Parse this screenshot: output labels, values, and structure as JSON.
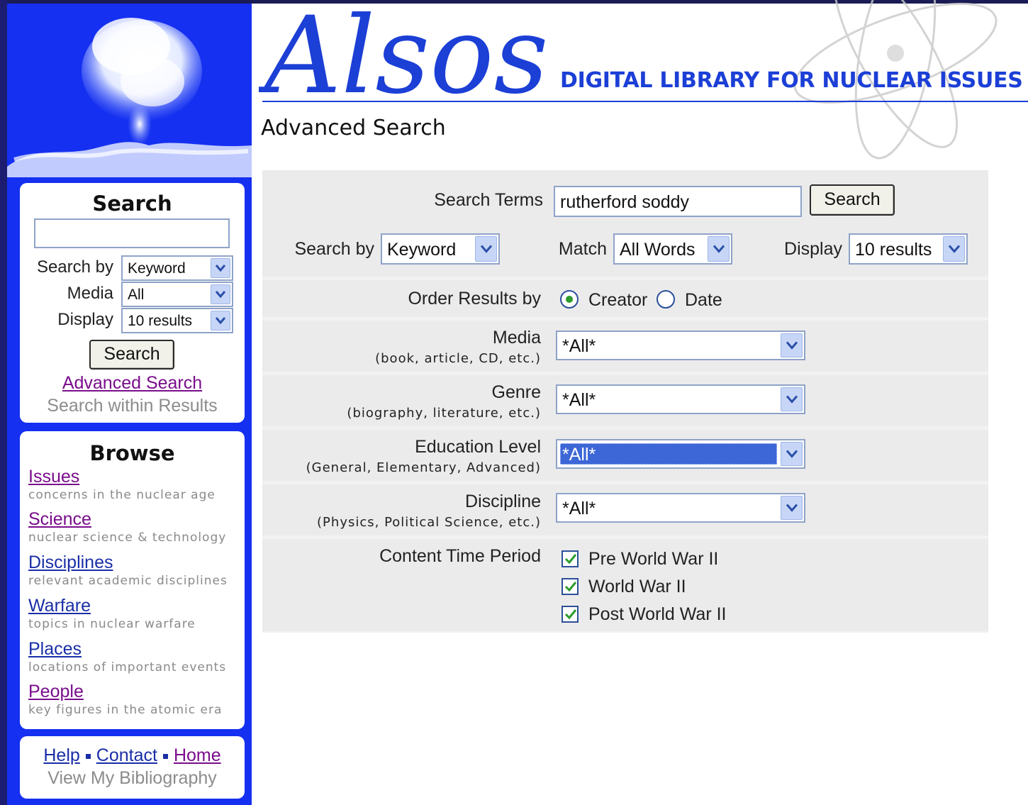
{
  "header": {
    "logo_text": "Alsos",
    "tagline": "DIGITAL LIBRARY FOR NUCLEAR ISSUES",
    "page_title": "Advanced Search"
  },
  "sidebar": {
    "search": {
      "title": "Search",
      "query_value": "",
      "search_by_label": "Search by",
      "search_by_value": "Keyword",
      "media_label": "Media",
      "media_value": "All",
      "display_label": "Display",
      "display_value": "10 results",
      "button_label": "Search",
      "advanced_link": "Advanced Search",
      "within_results": "Search within Results"
    },
    "browse": {
      "title": "Browse",
      "items": [
        {
          "label": "Issues",
          "desc": "concerns in the nuclear age"
        },
        {
          "label": "Science",
          "desc": "nuclear science & technology"
        },
        {
          "label": "Disciplines",
          "desc": "relevant academic disciplines"
        },
        {
          "label": "Warfare",
          "desc": "topics in nuclear warfare"
        },
        {
          "label": "Places",
          "desc": "locations of important events"
        },
        {
          "label": "People",
          "desc": "key figures in the atomic era"
        }
      ]
    },
    "footer": {
      "help": "Help",
      "contact": "Contact",
      "home": "Home",
      "bibliography": "View My Bibliography"
    }
  },
  "form": {
    "search_terms_label": "Search Terms",
    "search_terms_value": "rutherford soddy",
    "search_button": "Search",
    "search_by_label": "Search by",
    "search_by_value": "Keyword",
    "match_label": "Match",
    "match_value": "All Words",
    "display_label": "Display",
    "display_value": "10 results",
    "order_label": "Order Results by",
    "order_options": [
      {
        "label": "Creator",
        "selected": true
      },
      {
        "label": "Date",
        "selected": false
      }
    ],
    "media_label": "Media",
    "media_hint": "(book, article, CD, etc.)",
    "media_value": "*All*",
    "genre_label": "Genre",
    "genre_hint": "(biography, literature, etc.)",
    "genre_value": "*All*",
    "education_label": "Education Level",
    "education_hint": "(General, Elementary, Advanced)",
    "education_value": "*All*",
    "discipline_label": "Discipline",
    "discipline_hint": "(Physics, Political Science, etc.)",
    "discipline_value": "*All*",
    "period_label": "Content Time Period",
    "periods": [
      {
        "label": "Pre World War II",
        "checked": true
      },
      {
        "label": "World War II",
        "checked": true
      },
      {
        "label": "Post World War II",
        "checked": true
      }
    ]
  },
  "colors": {
    "sidebar_blue": "#1530f0",
    "brand_blue": "#1c3fd6",
    "visited_link": "#7a0d8c",
    "form_bg": "#ebebeb"
  }
}
